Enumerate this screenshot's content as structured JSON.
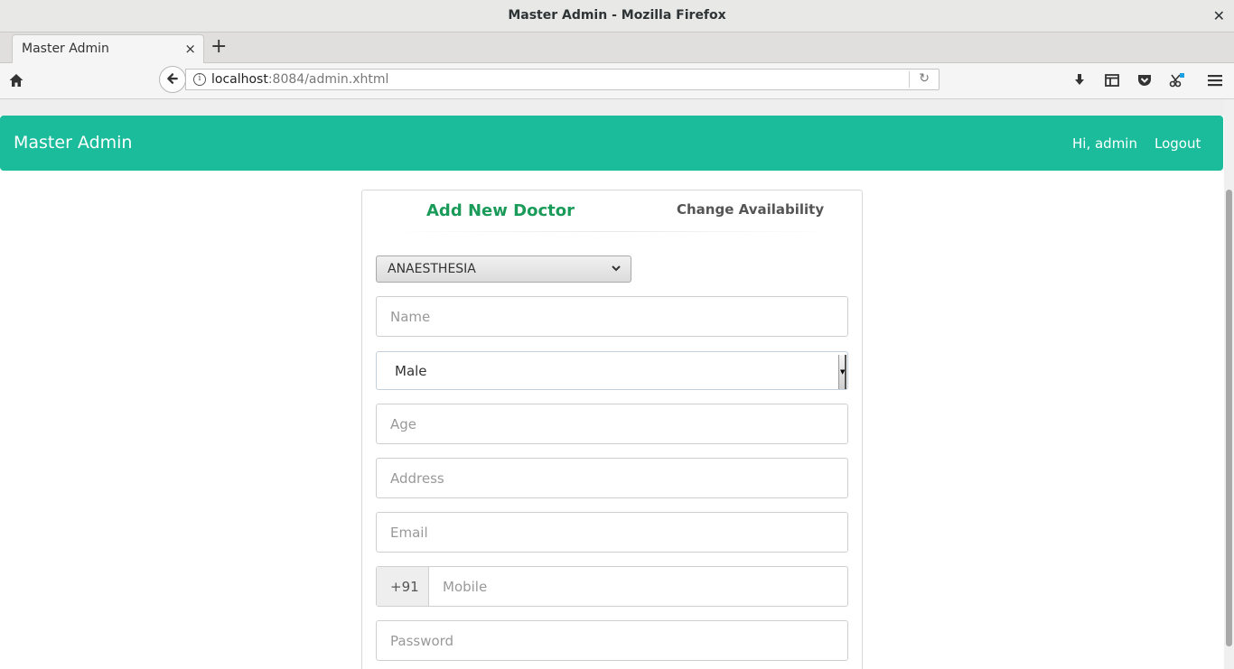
{
  "window": {
    "title": "Master Admin - Mozilla Firefox",
    "close_glyph": "✕"
  },
  "browser": {
    "tab_title": "Master Admin",
    "tab_close_glyph": "×",
    "new_tab_glyph": "+",
    "url_host": "localhost",
    "url_rest": ":8084/admin.xhtml",
    "url_info_glyph": "i",
    "reload_glyph": "↻",
    "icons": [
      "home-icon",
      "back-arrow-icon",
      "download-icon",
      "library-icon",
      "pocket-icon",
      "screenshot-icon",
      "menu-icon"
    ]
  },
  "header": {
    "brand": "Master Admin",
    "greeting": "Hi, admin",
    "logout": "Logout",
    "color": "#1abc9c"
  },
  "tabs": {
    "add": "Add New Doctor",
    "change": "Change Availability",
    "active_color": "#1a9b5a"
  },
  "form": {
    "department": "ANAESTHESIA",
    "name_placeholder": "Name",
    "gender_value": "Male",
    "age_placeholder": "Age",
    "address_placeholder": "Address",
    "email_placeholder": "Email",
    "mobile_prefix": "+91",
    "mobile_placeholder": "Mobile",
    "password_placeholder": "Password"
  }
}
